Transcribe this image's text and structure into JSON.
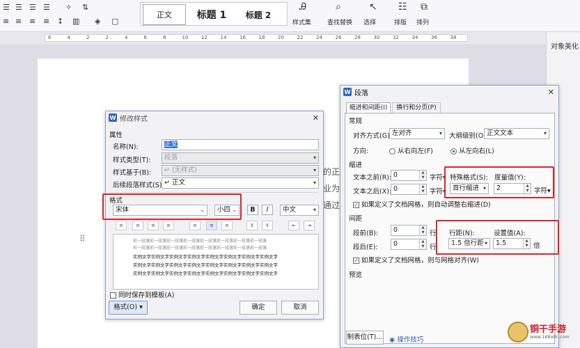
{
  "ribbon": {
    "styles": {
      "normal": "正文",
      "h1": "标题 1",
      "h2": "标题 2"
    },
    "labels": {
      "style_set": "样式集",
      "find_replace": "查找替换",
      "select": "选择",
      "layout": "排版",
      "arrange": "排列"
    }
  },
  "ruler": {
    "ticks": [
      "6",
      "4",
      "2",
      "2",
      "4",
      "6",
      "8",
      "10",
      "12",
      "14",
      "16",
      "18",
      "20",
      "22",
      "24",
      "26",
      "28",
      "30",
      "32",
      "34",
      "36",
      "38"
    ]
  },
  "right_panel": {
    "title": "对象美化"
  },
  "page_ghost": [
    "的正",
    "业为自",
    "通过"
  ],
  "modify_style": {
    "title": "修改样式",
    "props_label": "属性",
    "name_label": "名称(N):",
    "name_value": "正文",
    "type_label": "样式类型(T):",
    "type_value": "段落",
    "based_label": "样式基于(B):",
    "based_value": "↵ (无样式)",
    "follow_label": "后续段落样式(S):",
    "follow_value": "↵ 正文",
    "format_label": "格式",
    "font": "宋体",
    "size": "小四",
    "bold": "B",
    "italic": "I",
    "lang": "中文",
    "preview_gray": [
      "前一段落前一段落前一段落前一段落前一段落前一段落前一段落前一段落",
      "前一段落前一段落前一段落前一段落前一段落前一段落前一段落前一段落"
    ],
    "preview_dark": [
      "实例文字实例文字实例文字实例文字实例文字实例文字实例文字实例文字",
      "实例文字实例文字实例文字实例文字实例文字实例文字实例文字实例文字",
      "实例文字实例文字实例文字实例文字实例文字实例文字实例文字实例文字"
    ],
    "save_template": "同时保存到模板(A)",
    "format_btn": "格式(O)",
    "ok": "确定",
    "cancel": "取消"
  },
  "paragraph": {
    "title": "段落",
    "tabs": [
      "缩进和间距(I)",
      "换行和分页(P)"
    ],
    "general": "常规",
    "align_label": "对齐方式(G):",
    "align_value": "左对齐",
    "outline_label": "大纲级别(O):",
    "outline_value": "正文文本",
    "dir_label": "方向:",
    "rtl": "从右向左(F)",
    "ltr": "从左向右(L)",
    "indent": "缩进",
    "before_text_label": "文本之前(R):",
    "before_text_value": "0",
    "before_unit": "字符",
    "after_text_label": "文本之后(X):",
    "after_text_value": "0",
    "after_unit": "字符",
    "special_label": "特殊格式(S):",
    "special_value": "首行缩进",
    "measure_label": "度量值(Y):",
    "measure_value": "2",
    "measure_unit": "字符",
    "grid_indent": "如果定义了文档网格，则自动调整右缩进(D)",
    "spacing": "间距",
    "before_label": "段前(B):",
    "before_value": "0",
    "before_unit2": "行",
    "after_label": "段后(E):",
    "after_value": "0",
    "after_unit2": "行",
    "line_label": "行距(N):",
    "line_value": "1.5 倍行距",
    "set_label": "设置值(A):",
    "set_value": "1.5",
    "set_unit": "倍",
    "grid_align": "如果定义了文档网格，则与网格对齐(W)",
    "preview": "预览",
    "tabs_btn": "制表位(T)...",
    "tips": "操作技巧"
  },
  "watermark": {
    "text": "铜干手游",
    "url": "www.168xilc.com"
  }
}
